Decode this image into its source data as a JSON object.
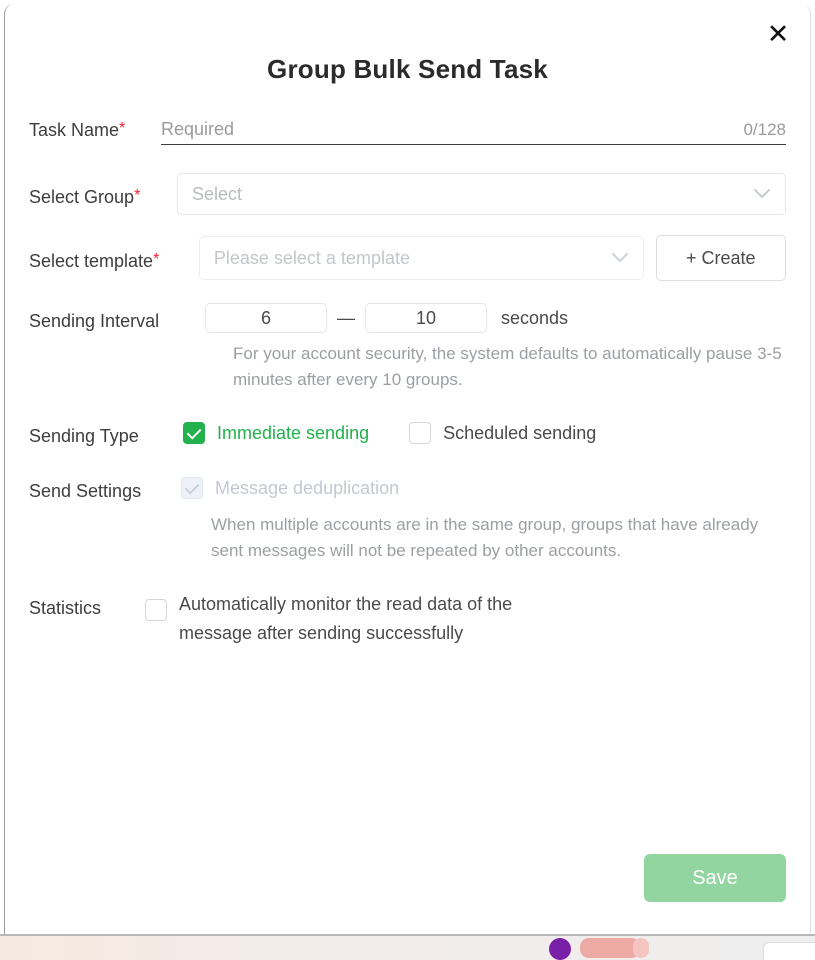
{
  "dialog": {
    "title": "Group Bulk Send Task",
    "close_icon": "close-icon"
  },
  "task_name": {
    "label": "Task Name",
    "required_mark": "*",
    "placeholder": "Required",
    "value": "",
    "counter": "0/128"
  },
  "select_group": {
    "label": "Select Group",
    "required_mark": "*",
    "value": "Select",
    "chevron": "∨"
  },
  "select_template": {
    "label": "Select template",
    "required_mark": "*",
    "value": "Please select a template",
    "chevron": "∨",
    "create_label": "+ Create"
  },
  "sending_interval": {
    "label": "Sending Interval",
    "min": "6",
    "max": "10",
    "dash": "—",
    "unit": "seconds",
    "hint": "For your account security, the system defaults to automatically pause 3-5 minutes after every 10 groups."
  },
  "sending_type": {
    "label": "Sending Type",
    "immediate_label": "Immediate sending",
    "immediate_checked": true,
    "scheduled_label": "Scheduled sending",
    "scheduled_checked": false
  },
  "send_settings": {
    "label": "Send Settings",
    "dedup_label": "Message deduplication",
    "dedup_checked": true,
    "dedup_disabled": true,
    "hint": "When multiple accounts are in the same group, groups that have already sent messages will not be repeated by other accounts."
  },
  "statistics": {
    "label": "Statistics",
    "checkbox_label": "Automatically monitor the read data of the message after sending successfully",
    "checked": false
  },
  "footer": {
    "save_label": "Save"
  },
  "colors": {
    "accent_green": "#22b14c",
    "save_button": "#92d5a0",
    "required_red": "#f5222d",
    "backdrop_green": "#1e4620"
  }
}
